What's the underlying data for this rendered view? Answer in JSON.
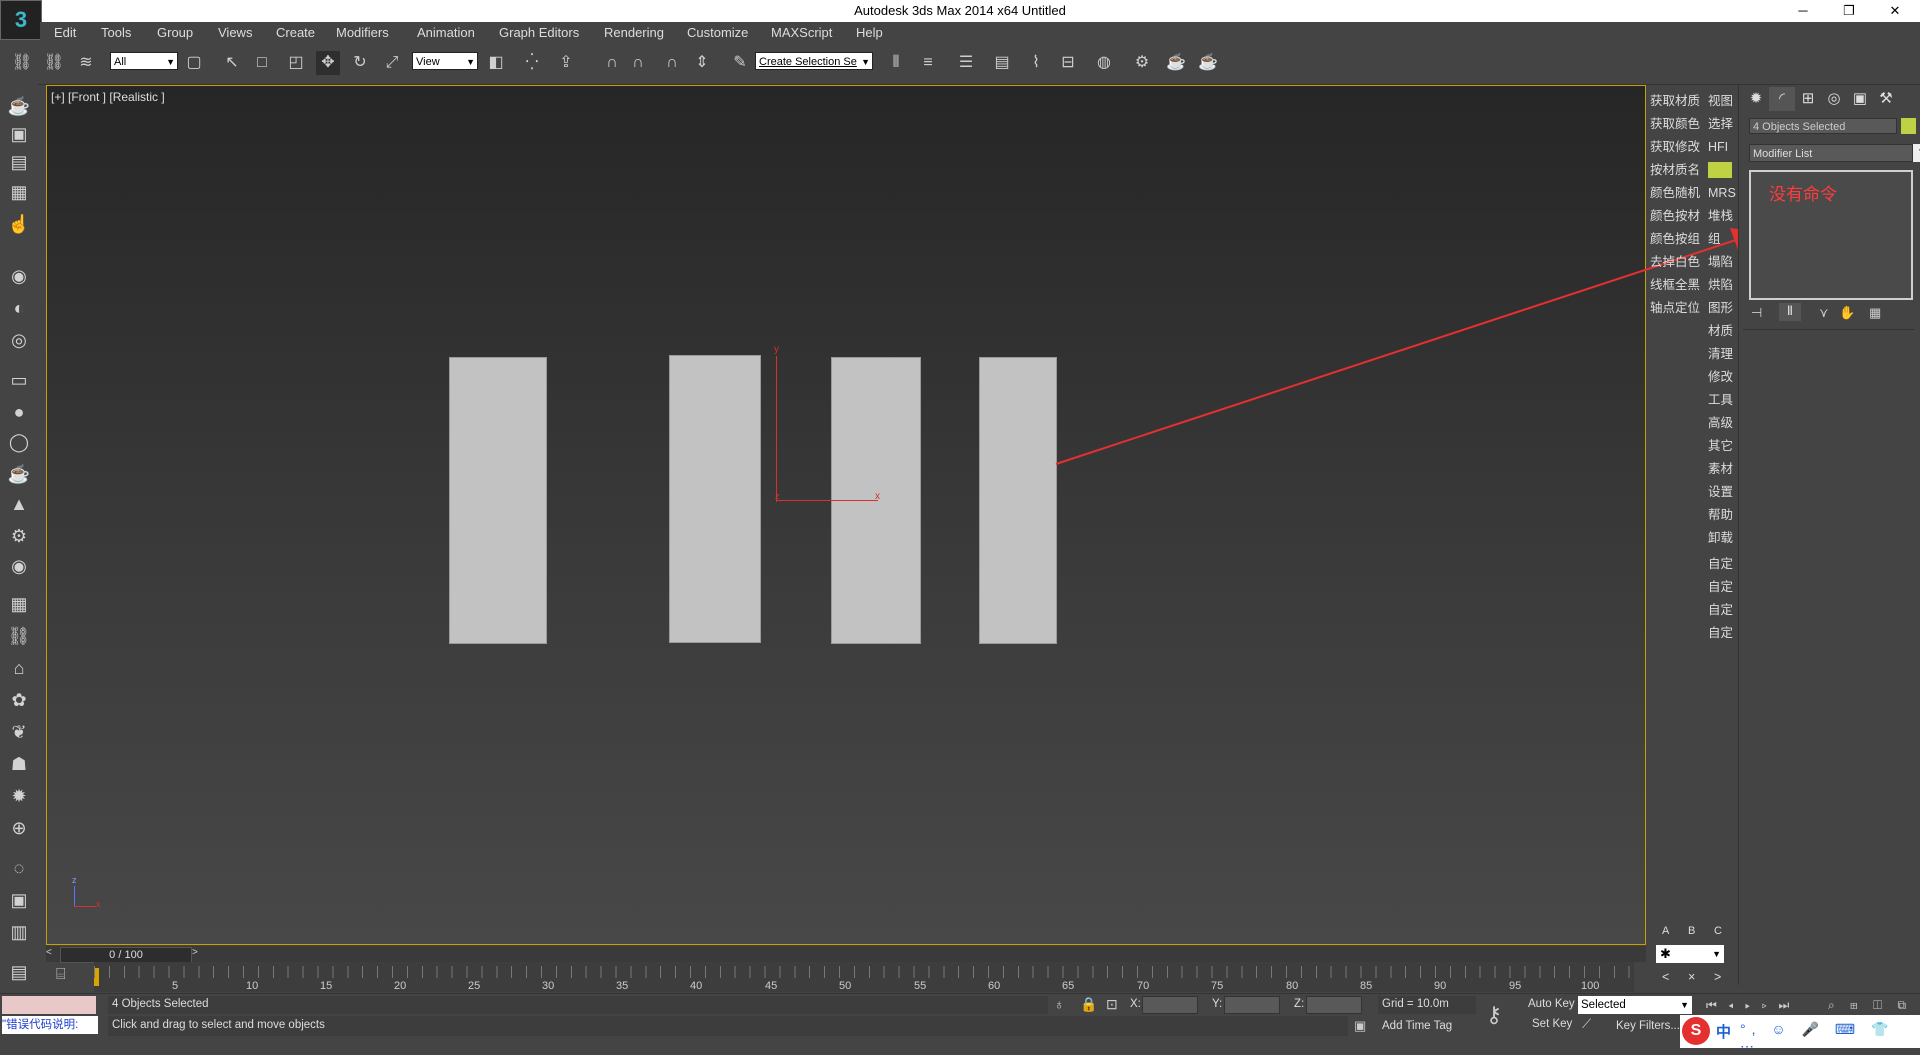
{
  "window": {
    "title": "Autodesk 3ds Max  2014 x64      Untitled",
    "minimize": "─",
    "maximize": "❐",
    "close": "✕"
  },
  "menu": {
    "items": [
      "Edit",
      "Tools",
      "Group",
      "Views",
      "Create",
      "Modifiers",
      "Animation",
      "Graph Editors",
      "Rendering",
      "Customize",
      "MAXScript",
      "Help"
    ]
  },
  "toolbar": {
    "selection_filter": "All",
    "reference_coord": "View",
    "named_selection": "Create Selection Se"
  },
  "viewport": {
    "label": "[+] [Front ] [Realistic ]",
    "gizmo_labels": {
      "y": "y",
      "x": "x",
      "z": "z"
    },
    "corner_axis": {
      "z": "z",
      "x": "x"
    }
  },
  "script_buttons": {
    "col1": [
      "获取材质",
      "获取颜色",
      "获取修改",
      "按材质名",
      "颜色随机",
      "颜色按材",
      "颜色按组",
      "去掉白色",
      "线框全黑",
      "轴点定位"
    ],
    "col2": [
      "视图",
      "选择",
      "HFI",
      "",
      "MRS",
      "堆栈",
      "组",
      "塌陷",
      "烘陷",
      "图形",
      "材质",
      "清理",
      "修改",
      "工具",
      "高级",
      "其它",
      "素材",
      "设置",
      "帮助",
      "卸载",
      "自定",
      "自定",
      "自定",
      "自定"
    ],
    "abc": [
      "A",
      "B",
      "C"
    ],
    "nav": [
      "<",
      "×",
      ">"
    ]
  },
  "command_panel": {
    "object_name": "4 Objects Selected",
    "object_color": "#bfd243",
    "modifier_list": "Modifier List",
    "stack_message": "没有命令"
  },
  "timeline": {
    "frame_label": "0 / 100",
    "ticks": [
      "5",
      "10",
      "15",
      "20",
      "25",
      "30",
      "35",
      "40",
      "45",
      "50",
      "55",
      "60",
      "65",
      "70",
      "75",
      "80",
      "85",
      "90",
      "95",
      "100"
    ]
  },
  "status": {
    "selection_info": "4 Objects Selected",
    "prompt": "Click and drag to select and move objects",
    "error_hint": "\"错误代码说明:",
    "x_label": "X:",
    "y_label": "Y:",
    "z_label": "Z:",
    "grid": "Grid = 10.0m",
    "add_time_tag": "Add Time Tag",
    "auto_key": "Auto Key",
    "set_key": "Set Key",
    "key_mode": "Selected",
    "key_filters": "Key Filters...",
    "ime": "中"
  }
}
